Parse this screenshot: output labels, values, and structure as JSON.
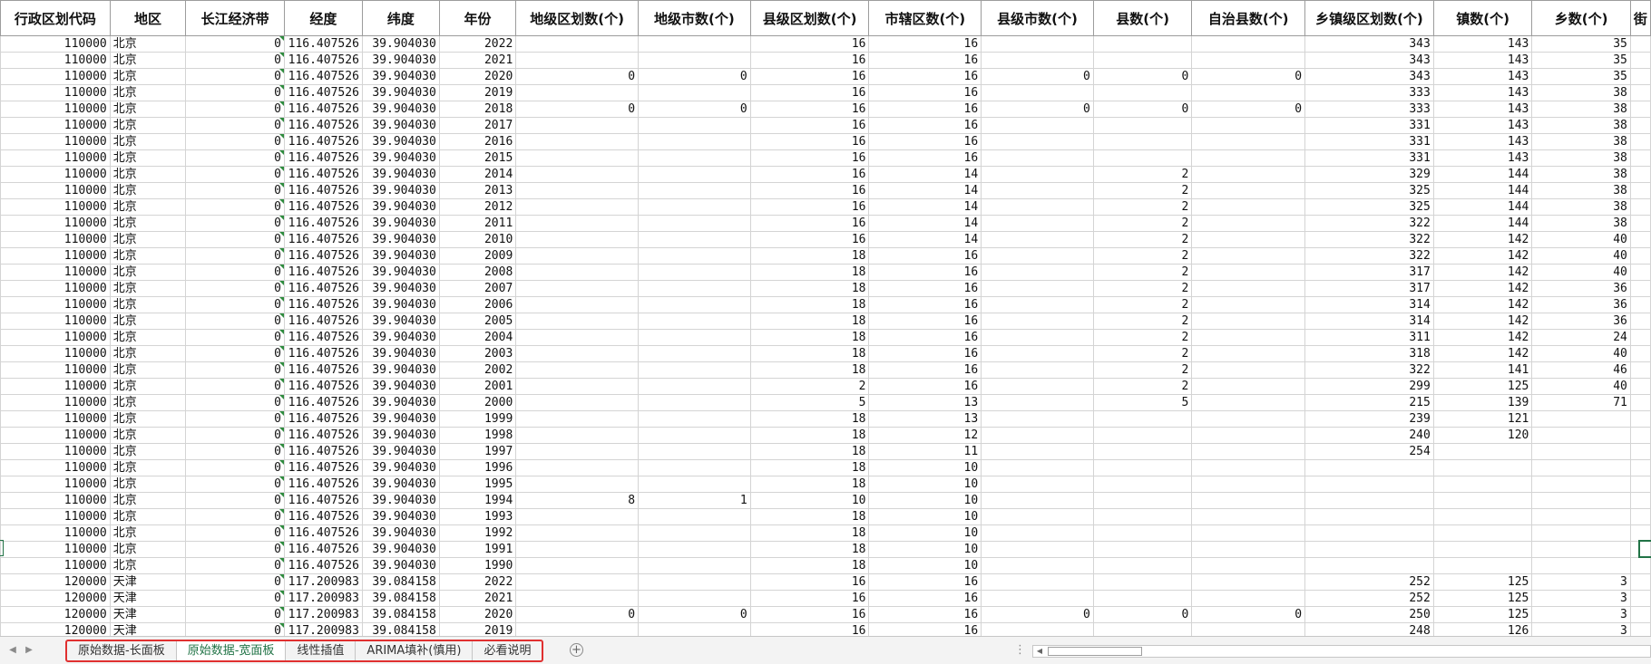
{
  "sheet": {
    "headers": [
      {
        "label": "行政区划代码",
        "width": 121
      },
      {
        "label": "地区",
        "width": 84
      },
      {
        "label": "长江经济带",
        "width": 109
      },
      {
        "label": "经度",
        "width": 86
      },
      {
        "label": "纬度",
        "width": 85
      },
      {
        "label": "年份",
        "width": 85
      },
      {
        "label": "地级区划数(个)",
        "width": 135
      },
      {
        "label": "地级市数(个)",
        "width": 124
      },
      {
        "label": "县级区划数(个)",
        "width": 131
      },
      {
        "label": "市辖区数(个)",
        "width": 124
      },
      {
        "label": "县级市数(个)",
        "width": 124
      },
      {
        "label": "县数(个)",
        "width": 109
      },
      {
        "label": "自治县数(个)",
        "width": 125
      },
      {
        "label": "乡镇级区划数(个)",
        "width": 142
      },
      {
        "label": "镇数(个)",
        "width": 109
      },
      {
        "label": "乡数(个)",
        "width": 109
      },
      {
        "label": "街",
        "width": 18
      }
    ],
    "rows": [
      [
        "110000",
        "北京",
        "0",
        "116.407526",
        "39.904030",
        "2022",
        "",
        "",
        "16",
        "16",
        "",
        "",
        "",
        "343",
        "143",
        "35",
        ""
      ],
      [
        "110000",
        "北京",
        "0",
        "116.407526",
        "39.904030",
        "2021",
        "",
        "",
        "16",
        "16",
        "",
        "",
        "",
        "343",
        "143",
        "35",
        ""
      ],
      [
        "110000",
        "北京",
        "0",
        "116.407526",
        "39.904030",
        "2020",
        "0",
        "0",
        "16",
        "16",
        "0",
        "0",
        "0",
        "343",
        "143",
        "35",
        ""
      ],
      [
        "110000",
        "北京",
        "0",
        "116.407526",
        "39.904030",
        "2019",
        "",
        "",
        "16",
        "16",
        "",
        "",
        "",
        "333",
        "143",
        "38",
        ""
      ],
      [
        "110000",
        "北京",
        "0",
        "116.407526",
        "39.904030",
        "2018",
        "0",
        "0",
        "16",
        "16",
        "0",
        "0",
        "0",
        "333",
        "143",
        "38",
        ""
      ],
      [
        "110000",
        "北京",
        "0",
        "116.407526",
        "39.904030",
        "2017",
        "",
        "",
        "16",
        "16",
        "",
        "",
        "",
        "331",
        "143",
        "38",
        ""
      ],
      [
        "110000",
        "北京",
        "0",
        "116.407526",
        "39.904030",
        "2016",
        "",
        "",
        "16",
        "16",
        "",
        "",
        "",
        "331",
        "143",
        "38",
        ""
      ],
      [
        "110000",
        "北京",
        "0",
        "116.407526",
        "39.904030",
        "2015",
        "",
        "",
        "16",
        "16",
        "",
        "",
        "",
        "331",
        "143",
        "38",
        ""
      ],
      [
        "110000",
        "北京",
        "0",
        "116.407526",
        "39.904030",
        "2014",
        "",
        "",
        "16",
        "14",
        "",
        "2",
        "",
        "329",
        "144",
        "38",
        ""
      ],
      [
        "110000",
        "北京",
        "0",
        "116.407526",
        "39.904030",
        "2013",
        "",
        "",
        "16",
        "14",
        "",
        "2",
        "",
        "325",
        "144",
        "38",
        ""
      ],
      [
        "110000",
        "北京",
        "0",
        "116.407526",
        "39.904030",
        "2012",
        "",
        "",
        "16",
        "14",
        "",
        "2",
        "",
        "325",
        "144",
        "38",
        ""
      ],
      [
        "110000",
        "北京",
        "0",
        "116.407526",
        "39.904030",
        "2011",
        "",
        "",
        "16",
        "14",
        "",
        "2",
        "",
        "322",
        "144",
        "38",
        ""
      ],
      [
        "110000",
        "北京",
        "0",
        "116.407526",
        "39.904030",
        "2010",
        "",
        "",
        "16",
        "14",
        "",
        "2",
        "",
        "322",
        "142",
        "40",
        ""
      ],
      [
        "110000",
        "北京",
        "0",
        "116.407526",
        "39.904030",
        "2009",
        "",
        "",
        "18",
        "16",
        "",
        "2",
        "",
        "322",
        "142",
        "40",
        ""
      ],
      [
        "110000",
        "北京",
        "0",
        "116.407526",
        "39.904030",
        "2008",
        "",
        "",
        "18",
        "16",
        "",
        "2",
        "",
        "317",
        "142",
        "40",
        ""
      ],
      [
        "110000",
        "北京",
        "0",
        "116.407526",
        "39.904030",
        "2007",
        "",
        "",
        "18",
        "16",
        "",
        "2",
        "",
        "317",
        "142",
        "36",
        ""
      ],
      [
        "110000",
        "北京",
        "0",
        "116.407526",
        "39.904030",
        "2006",
        "",
        "",
        "18",
        "16",
        "",
        "2",
        "",
        "314",
        "142",
        "36",
        ""
      ],
      [
        "110000",
        "北京",
        "0",
        "116.407526",
        "39.904030",
        "2005",
        "",
        "",
        "18",
        "16",
        "",
        "2",
        "",
        "314",
        "142",
        "36",
        ""
      ],
      [
        "110000",
        "北京",
        "0",
        "116.407526",
        "39.904030",
        "2004",
        "",
        "",
        "18",
        "16",
        "",
        "2",
        "",
        "311",
        "142",
        "24",
        ""
      ],
      [
        "110000",
        "北京",
        "0",
        "116.407526",
        "39.904030",
        "2003",
        "",
        "",
        "18",
        "16",
        "",
        "2",
        "",
        "318",
        "142",
        "40",
        ""
      ],
      [
        "110000",
        "北京",
        "0",
        "116.407526",
        "39.904030",
        "2002",
        "",
        "",
        "18",
        "16",
        "",
        "2",
        "",
        "322",
        "141",
        "46",
        ""
      ],
      [
        "110000",
        "北京",
        "0",
        "116.407526",
        "39.904030",
        "2001",
        "",
        "",
        "2",
        "16",
        "",
        "2",
        "",
        "299",
        "125",
        "40",
        ""
      ],
      [
        "110000",
        "北京",
        "0",
        "116.407526",
        "39.904030",
        "2000",
        "",
        "",
        "5",
        "13",
        "",
        "5",
        "",
        "215",
        "139",
        "71",
        ""
      ],
      [
        "110000",
        "北京",
        "0",
        "116.407526",
        "39.904030",
        "1999",
        "",
        "",
        "18",
        "13",
        "",
        "",
        "",
        "239",
        "121",
        "",
        ""
      ],
      [
        "110000",
        "北京",
        "0",
        "116.407526",
        "39.904030",
        "1998",
        "",
        "",
        "18",
        "12",
        "",
        "",
        "",
        "240",
        "120",
        "",
        ""
      ],
      [
        "110000",
        "北京",
        "0",
        "116.407526",
        "39.904030",
        "1997",
        "",
        "",
        "18",
        "11",
        "",
        "",
        "",
        "254",
        "",
        "",
        ""
      ],
      [
        "110000",
        "北京",
        "0",
        "116.407526",
        "39.904030",
        "1996",
        "",
        "",
        "18",
        "10",
        "",
        "",
        "",
        "",
        "",
        "",
        ""
      ],
      [
        "110000",
        "北京",
        "0",
        "116.407526",
        "39.904030",
        "1995",
        "",
        "",
        "18",
        "10",
        "",
        "",
        "",
        "",
        "",
        "",
        ""
      ],
      [
        "110000",
        "北京",
        "0",
        "116.407526",
        "39.904030",
        "1994",
        "8",
        "1",
        "10",
        "10",
        "",
        "",
        "",
        "",
        "",
        "",
        ""
      ],
      [
        "110000",
        "北京",
        "0",
        "116.407526",
        "39.904030",
        "1993",
        "",
        "",
        "18",
        "10",
        "",
        "",
        "",
        "",
        "",
        "",
        ""
      ],
      [
        "110000",
        "北京",
        "0",
        "116.407526",
        "39.904030",
        "1992",
        "",
        "",
        "18",
        "10",
        "",
        "",
        "",
        "",
        "",
        "",
        ""
      ],
      [
        "110000",
        "北京",
        "0",
        "116.407526",
        "39.904030",
        "1991",
        "",
        "",
        "18",
        "10",
        "",
        "",
        "",
        "",
        "",
        "",
        ""
      ],
      [
        "110000",
        "北京",
        "0",
        "116.407526",
        "39.904030",
        "1990",
        "",
        "",
        "18",
        "10",
        "",
        "",
        "",
        "",
        "",
        "",
        ""
      ],
      [
        "120000",
        "天津",
        "0",
        "117.200983",
        "39.084158",
        "2022",
        "",
        "",
        "16",
        "16",
        "",
        "",
        "",
        "252",
        "125",
        "3",
        ""
      ],
      [
        "120000",
        "天津",
        "0",
        "117.200983",
        "39.084158",
        "2021",
        "",
        "",
        "16",
        "16",
        "",
        "",
        "",
        "252",
        "125",
        "3",
        ""
      ],
      [
        "120000",
        "天津",
        "0",
        "117.200983",
        "39.084158",
        "2020",
        "0",
        "0",
        "16",
        "16",
        "0",
        "0",
        "0",
        "250",
        "125",
        "3",
        ""
      ],
      [
        "120000",
        "天津",
        "0",
        "117.200983",
        "39.084158",
        "2019",
        "",
        "",
        "16",
        "16",
        "",
        "",
        "",
        "248",
        "126",
        "3",
        ""
      ]
    ]
  },
  "tabs": [
    {
      "label": "原始数据-长面板",
      "active": false
    },
    {
      "label": "原始数据-宽面板",
      "active": true
    },
    {
      "label": "线性插值",
      "active": false
    },
    {
      "label": "ARIMA填补(慎用)",
      "active": false
    },
    {
      "label": "必看说明",
      "active": false
    }
  ],
  "status": {
    "add_sheet": "+",
    "more": "⋮",
    "nav_prev": "◀",
    "nav_next": "▶",
    "scroll_left": "◀"
  },
  "colors": {
    "accent": "#217346",
    "highlight_border": "#e03030",
    "grid_line": "#d4d4d4"
  }
}
